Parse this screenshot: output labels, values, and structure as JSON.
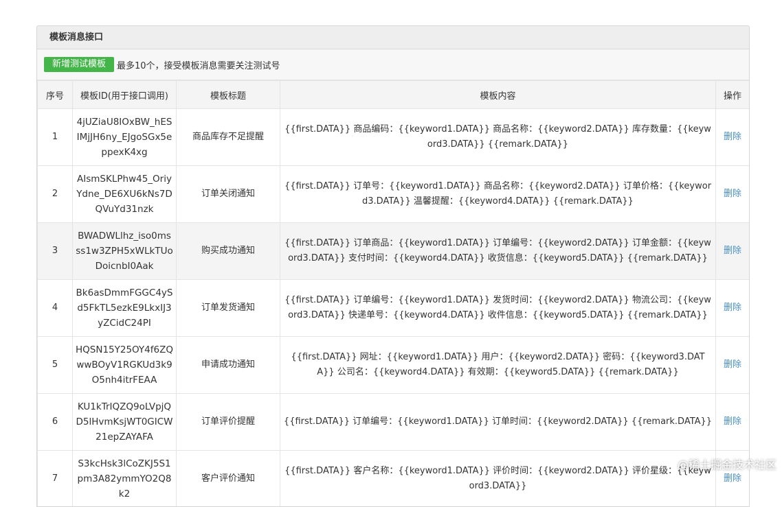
{
  "panel": {
    "title": "模板消息接口",
    "add_button": "新增测试模板",
    "note": "最多10个，接受模板消息需要关注测试号"
  },
  "table": {
    "headers": [
      "序号",
      "模板ID(用于接口调用)",
      "模板标题",
      "模板内容",
      "操作"
    ],
    "rows": [
      {
        "num": "1",
        "id": "4jUZiaU8IOxBW_hESIMjJH6ny_EJgoSGx5eppexK4xg",
        "title": "商品库存不足提醒",
        "content": "{{first.DATA}} 商品编码：{{keyword1.DATA}} 商品名称：{{keyword2.DATA}} 库存数量：{{keyword3.DATA}} {{remark.DATA}}",
        "action": "删除"
      },
      {
        "num": "2",
        "id": "AIsmSKLPhw45_OriyYdne_DE6XU6kNs7DQVuYd31nzk",
        "title": "订单关闭通知",
        "content": "{{first.DATA}} 订单号：{{keyword1.DATA}} 商品名称：{{keyword2.DATA}} 订单价格：{{keyword3.DATA}} 温馨提醒：{{keyword4.DATA}} {{remark.DATA}}",
        "action": "删除"
      },
      {
        "num": "3",
        "id": "BWADWLlhz_iso0msss1w3ZPH5xWLkTUoDoicnbI0Aak",
        "title": "购买成功通知",
        "content": "{{first.DATA}} 订单商品：{{keyword1.DATA}} 订单编号：{{keyword2.DATA}} 订单金额：{{keyword3.DATA}} 支付时间：{{keyword4.DATA}} 收货信息：{{keyword5.DATA}} {{remark.DATA}}",
        "action": "删除"
      },
      {
        "num": "4",
        "id": "Bk6asDmmFGGC4ySd5FkTL5ezkE9LkxIJ3yZCidC24PI",
        "title": "订单发货通知",
        "content": "{{first.DATA}} 订单编号：{{keyword1.DATA}} 发货时间：{{keyword2.DATA}} 物流公司：{{keyword3.DATA}} 快递单号：{{keyword4.DATA}} 收件信息：{{keyword5.DATA}} {{remark.DATA}}",
        "action": "删除"
      },
      {
        "num": "5",
        "id": "HQSN15Y25OY4f6ZQwwBOyV1RGKUd3k9O5nh4itrFEAA",
        "title": "申请成功通知",
        "content": "{{first.DATA}} 网址：{{keyword1.DATA}} 用户：{{keyword2.DATA}} 密码：{{keyword3.DATA}} 公司名：{{keyword4.DATA}} 有效期：{{keyword5.DATA}} {{remark.DATA}}",
        "action": "删除"
      },
      {
        "num": "6",
        "id": "KU1kTrIQZQ9oLVpjQD5lHvmKsjWT0GICW21epZAYAFA",
        "title": "订单评价提醒",
        "content": "{{first.DATA}} 订单编号：{{keyword1.DATA}} 订单时间：{{keyword2.DATA}} {{remark.DATA}}",
        "action": "删除"
      },
      {
        "num": "7",
        "id": "S3kcHsk3lCoZKJ5S1pm3A82ymmYO2Q8k2",
        "title": "客户评价通知",
        "content": "{{first.DATA}} 客户名称：{{keyword1.DATA}} 评价时间：{{keyword2.DATA}} 评价星级：{{keyword3.DATA}}",
        "action": "删除"
      }
    ]
  },
  "watermark": "@稀土掘金技术社区",
  "colors": {
    "add_button": "#44b549",
    "link": "#4a90c8",
    "header_bg": "#eeeeee"
  }
}
